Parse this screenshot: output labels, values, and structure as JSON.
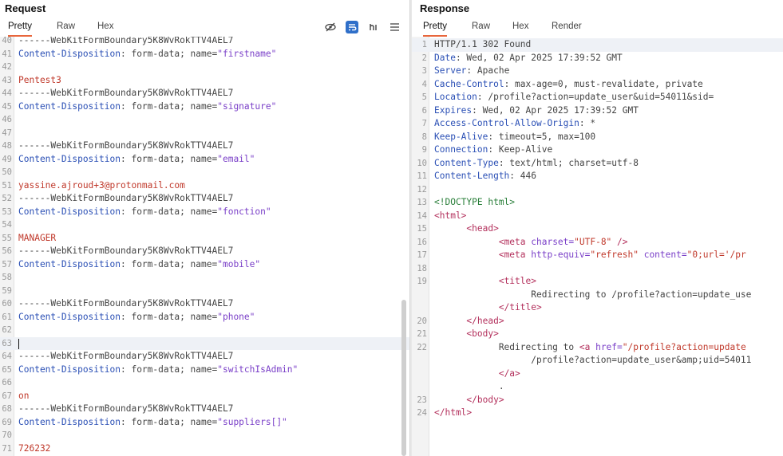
{
  "request": {
    "title": "Request",
    "tabs": [
      "Pretty",
      "Raw",
      "Hex"
    ],
    "active_tab": "Pretty",
    "toolbar_icons": [
      "hide-icon",
      "wrap-icon",
      "newline-icon",
      "menu-icon"
    ],
    "lines": [
      {
        "n": "40",
        "parts": [
          {
            "c": "v",
            "t": "------WebKitFormBoundary5K8WvRokTTV4AEL7"
          }
        ]
      },
      {
        "n": "41",
        "parts": [
          {
            "c": "k",
            "t": "Content-Disposition"
          },
          {
            "c": "v",
            "t": ": form-data; name="
          },
          {
            "c": "q",
            "t": "\"firstname\""
          }
        ]
      },
      {
        "n": "42",
        "parts": []
      },
      {
        "n": "43",
        "parts": [
          {
            "c": "r",
            "t": "Pentest3"
          }
        ]
      },
      {
        "n": "44",
        "parts": [
          {
            "c": "v",
            "t": "------WebKitFormBoundary5K8WvRokTTV4AEL7"
          }
        ]
      },
      {
        "n": "45",
        "parts": [
          {
            "c": "k",
            "t": "Content-Disposition"
          },
          {
            "c": "v",
            "t": ": form-data; name="
          },
          {
            "c": "q",
            "t": "\"signature\""
          }
        ]
      },
      {
        "n": "46",
        "parts": []
      },
      {
        "n": "47",
        "parts": []
      },
      {
        "n": "48",
        "parts": [
          {
            "c": "v",
            "t": "------WebKitFormBoundary5K8WvRokTTV4AEL7"
          }
        ]
      },
      {
        "n": "49",
        "parts": [
          {
            "c": "k",
            "t": "Content-Disposition"
          },
          {
            "c": "v",
            "t": ": form-data; name="
          },
          {
            "c": "q",
            "t": "\"email\""
          }
        ]
      },
      {
        "n": "50",
        "parts": []
      },
      {
        "n": "51",
        "parts": [
          {
            "c": "r",
            "t": "yassine.ajroud+3@protonmail.com"
          }
        ]
      },
      {
        "n": "52",
        "parts": [
          {
            "c": "v",
            "t": "------WebKitFormBoundary5K8WvRokTTV4AEL7"
          }
        ]
      },
      {
        "n": "53",
        "parts": [
          {
            "c": "k",
            "t": "Content-Disposition"
          },
          {
            "c": "v",
            "t": ": form-data; name="
          },
          {
            "c": "q",
            "t": "\"fonction\""
          }
        ]
      },
      {
        "n": "54",
        "parts": []
      },
      {
        "n": "55",
        "parts": [
          {
            "c": "r",
            "t": "MANAGER"
          }
        ]
      },
      {
        "n": "56",
        "parts": [
          {
            "c": "v",
            "t": "------WebKitFormBoundary5K8WvRokTTV4AEL7"
          }
        ]
      },
      {
        "n": "57",
        "parts": [
          {
            "c": "k",
            "t": "Content-Disposition"
          },
          {
            "c": "v",
            "t": ": form-data; name="
          },
          {
            "c": "q",
            "t": "\"mobile\""
          }
        ]
      },
      {
        "n": "58",
        "parts": []
      },
      {
        "n": "59",
        "parts": []
      },
      {
        "n": "60",
        "parts": [
          {
            "c": "v",
            "t": "------WebKitFormBoundary5K8WvRokTTV4AEL7"
          }
        ]
      },
      {
        "n": "61",
        "parts": [
          {
            "c": "k",
            "t": "Content-Disposition"
          },
          {
            "c": "v",
            "t": ": form-data; name="
          },
          {
            "c": "q",
            "t": "\"phone\""
          }
        ]
      },
      {
        "n": "62",
        "parts": []
      },
      {
        "n": "63",
        "parts": [],
        "highlight": true,
        "caret": true
      },
      {
        "n": "64",
        "parts": [
          {
            "c": "v",
            "t": "------WebKitFormBoundary5K8WvRokTTV4AEL7"
          }
        ]
      },
      {
        "n": "65",
        "parts": [
          {
            "c": "k",
            "t": "Content-Disposition"
          },
          {
            "c": "v",
            "t": ": form-data; name="
          },
          {
            "c": "q",
            "t": "\"switchIsAdmin\""
          }
        ]
      },
      {
        "n": "66",
        "parts": []
      },
      {
        "n": "67",
        "parts": [
          {
            "c": "r",
            "t": "on"
          }
        ]
      },
      {
        "n": "68",
        "parts": [
          {
            "c": "v",
            "t": "------WebKitFormBoundary5K8WvRokTTV4AEL7"
          }
        ]
      },
      {
        "n": "69",
        "parts": [
          {
            "c": "k",
            "t": "Content-Disposition"
          },
          {
            "c": "v",
            "t": ": form-data; name="
          },
          {
            "c": "q",
            "t": "\"suppliers[]\""
          }
        ]
      },
      {
        "n": "70",
        "parts": []
      },
      {
        "n": "71",
        "parts": [
          {
            "c": "r",
            "t": "726232"
          }
        ]
      }
    ]
  },
  "response": {
    "title": "Response",
    "tabs": [
      "Pretty",
      "Raw",
      "Hex",
      "Render"
    ],
    "active_tab": "Pretty",
    "lines": [
      {
        "n": "1",
        "parts": [
          {
            "c": "v",
            "t": "HTTP/1.1 302 Found"
          }
        ],
        "highlight": true
      },
      {
        "n": "2",
        "parts": [
          {
            "c": "k",
            "t": "Date"
          },
          {
            "c": "v",
            "t": ": Wed, 02 Apr 2025 17:39:52 GMT"
          }
        ]
      },
      {
        "n": "3",
        "parts": [
          {
            "c": "k",
            "t": "Server"
          },
          {
            "c": "v",
            "t": ": Apache"
          }
        ]
      },
      {
        "n": "4",
        "parts": [
          {
            "c": "k",
            "t": "Cache-Control"
          },
          {
            "c": "v",
            "t": ": max-age=0, must-revalidate, private"
          }
        ]
      },
      {
        "n": "5",
        "parts": [
          {
            "c": "k",
            "t": "Location"
          },
          {
            "c": "v",
            "t": ": /profile?action=update_user&uid=54011&sid="
          }
        ]
      },
      {
        "n": "6",
        "parts": [
          {
            "c": "k",
            "t": "Expires"
          },
          {
            "c": "v",
            "t": ": Wed, 02 Apr 2025 17:39:52 GMT"
          }
        ]
      },
      {
        "n": "7",
        "parts": [
          {
            "c": "k",
            "t": "Access-Control-Allow-Origin"
          },
          {
            "c": "v",
            "t": ": *"
          }
        ]
      },
      {
        "n": "8",
        "parts": [
          {
            "c": "k",
            "t": "Keep-Alive"
          },
          {
            "c": "v",
            "t": ": timeout=5, max=100"
          }
        ]
      },
      {
        "n": "9",
        "parts": [
          {
            "c": "k",
            "t": "Connection"
          },
          {
            "c": "v",
            "t": ": Keep-Alive"
          }
        ]
      },
      {
        "n": "10",
        "parts": [
          {
            "c": "k",
            "t": "Content-Type"
          },
          {
            "c": "v",
            "t": ": text/html; charset=utf-8"
          }
        ]
      },
      {
        "n": "11",
        "parts": [
          {
            "c": "k",
            "t": "Content-Length"
          },
          {
            "c": "v",
            "t": ": 446"
          }
        ]
      },
      {
        "n": "12",
        "parts": []
      },
      {
        "n": "13",
        "parts": [
          {
            "c": "doctype",
            "t": "<!DOCTYPE html>"
          }
        ]
      },
      {
        "n": "14",
        "parts": [
          {
            "c": "tag",
            "t": "<html>"
          }
        ]
      },
      {
        "n": "15",
        "parts": [
          {
            "c": "v",
            "t": "      "
          },
          {
            "c": "tag",
            "t": "<head>"
          }
        ]
      },
      {
        "n": "16",
        "parts": [
          {
            "c": "v",
            "t": "            "
          },
          {
            "c": "tag",
            "t": "<meta "
          },
          {
            "c": "attr",
            "t": "charset="
          },
          {
            "c": "str",
            "t": "\"UTF-8\""
          },
          {
            "c": "tag",
            "t": " />"
          }
        ]
      },
      {
        "n": "17",
        "parts": [
          {
            "c": "v",
            "t": "            "
          },
          {
            "c": "tag",
            "t": "<meta "
          },
          {
            "c": "attr",
            "t": "http-equiv="
          },
          {
            "c": "str",
            "t": "\"refresh\""
          },
          {
            "c": "attr",
            "t": " content="
          },
          {
            "c": "str",
            "t": "\"0;url='/pr"
          }
        ]
      },
      {
        "n": "18",
        "parts": []
      },
      {
        "n": "19",
        "parts": [
          {
            "c": "v",
            "t": "            "
          },
          {
            "c": "tag",
            "t": "<title>"
          }
        ]
      },
      {
        "n": "",
        "parts": [
          {
            "c": "v",
            "t": "                  Redirecting to /profile?action=update_use"
          }
        ]
      },
      {
        "n": "",
        "parts": [
          {
            "c": "v",
            "t": "            "
          },
          {
            "c": "tag",
            "t": "</title>"
          }
        ]
      },
      {
        "n": "20",
        "parts": [
          {
            "c": "v",
            "t": "      "
          },
          {
            "c": "tag",
            "t": "</head>"
          }
        ]
      },
      {
        "n": "21",
        "parts": [
          {
            "c": "v",
            "t": "      "
          },
          {
            "c": "tag",
            "t": "<body>"
          }
        ]
      },
      {
        "n": "22",
        "parts": [
          {
            "c": "v",
            "t": "            Redirecting to "
          },
          {
            "c": "tag",
            "t": "<a "
          },
          {
            "c": "attr",
            "t": "href="
          },
          {
            "c": "str",
            "t": "\"/profile?action=update"
          }
        ]
      },
      {
        "n": "",
        "parts": [
          {
            "c": "v",
            "t": "                  /profile?action=update_user&amp;uid=54011"
          }
        ]
      },
      {
        "n": "",
        "parts": [
          {
            "c": "v",
            "t": "            "
          },
          {
            "c": "tag",
            "t": "</a>"
          }
        ]
      },
      {
        "n": "",
        "parts": [
          {
            "c": "v",
            "t": "            ."
          }
        ]
      },
      {
        "n": "23",
        "parts": [
          {
            "c": "v",
            "t": "      "
          },
          {
            "c": "tag",
            "t": "</body>"
          }
        ]
      },
      {
        "n": "24",
        "parts": [
          {
            "c": "tag",
            "t": "</html>"
          }
        ]
      }
    ]
  }
}
